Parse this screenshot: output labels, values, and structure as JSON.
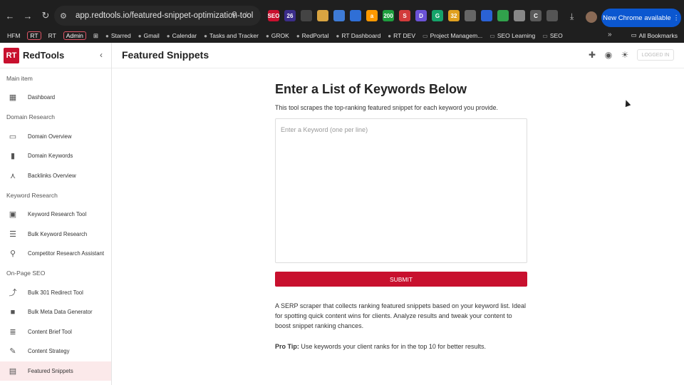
{
  "browser": {
    "url": "app.redtools.io/featured-snippet-optimization-tool",
    "new_chrome_label": "New Chrome available",
    "bookmarks": [
      {
        "label": "HFM",
        "icon": "text"
      },
      {
        "label": "RT",
        "icon": "badge"
      },
      {
        "label": "RT",
        "icon": "text"
      },
      {
        "label": "Admin",
        "icon": "badge"
      },
      {
        "label": "Starred",
        "icon": "drive-icon"
      },
      {
        "label": "Gmail",
        "icon": "gmail-icon"
      },
      {
        "label": "Calendar",
        "icon": "calendar-icon"
      },
      {
        "label": "Tasks and Tracker",
        "icon": "sheets-icon"
      },
      {
        "label": "GROK",
        "icon": "grok-icon"
      },
      {
        "label": "RedPortal",
        "icon": "portal-icon"
      },
      {
        "label": "RT Dashboard",
        "icon": "rt-icon"
      },
      {
        "label": "RT DEV",
        "icon": "dev-icon"
      },
      {
        "label": "Project Managem...",
        "icon": "folder-icon"
      },
      {
        "label": "SEO Learning",
        "icon": "folder-icon"
      },
      {
        "label": "SEO",
        "icon": "folder-icon"
      }
    ],
    "all_bookmarks_label": "All Bookmarks",
    "extensions": [
      {
        "label": "SEO",
        "color": "#c8102e"
      },
      {
        "label": "26",
        "color": "#3b2d8a"
      },
      {
        "label": "",
        "color": "#444444"
      },
      {
        "label": "",
        "color": "#d9a441"
      },
      {
        "label": "",
        "color": "#3e7bd6"
      },
      {
        "label": "",
        "color": "#2f6fd6"
      },
      {
        "label": "a",
        "color": "#ff9900"
      },
      {
        "label": "200",
        "color": "#1e9e3e"
      },
      {
        "label": "S",
        "color": "#d23b3b"
      },
      {
        "label": "D",
        "color": "#6b52d6"
      },
      {
        "label": "G",
        "color": "#15a36a"
      },
      {
        "label": "32",
        "color": "#e0a020"
      },
      {
        "label": "",
        "color": "#666666"
      },
      {
        "label": "",
        "color": "#2a62d6"
      },
      {
        "label": "",
        "color": "#31a24c"
      },
      {
        "label": "",
        "color": "#888888"
      },
      {
        "label": "C",
        "color": "#5a5a5a"
      },
      {
        "label": "",
        "color": "#555555"
      }
    ]
  },
  "sidebar": {
    "brand_logo": "RT",
    "brand_name": "RedTools",
    "sections": [
      {
        "title": "Main item",
        "items": [
          {
            "label": "Dashboard",
            "icon": "dashboard-icon",
            "glyph": "▦"
          }
        ]
      },
      {
        "title": "Domain Research",
        "items": [
          {
            "label": "Domain Overview",
            "icon": "laptop-search-icon",
            "glyph": "▭"
          },
          {
            "label": "Domain Keywords",
            "icon": "bar-chart-icon",
            "glyph": "▮"
          },
          {
            "label": "Backlinks Overview",
            "icon": "hub-icon",
            "glyph": "⋏"
          }
        ]
      },
      {
        "title": "Keyword Research",
        "items": [
          {
            "label": "Keyword Research Tool",
            "icon": "image-search-icon",
            "glyph": "▣"
          },
          {
            "label": "Bulk Keyword Research",
            "icon": "list-icon",
            "glyph": "☰"
          },
          {
            "label": "Competitor Research Assistant",
            "icon": "search-icon",
            "glyph": "⚲"
          }
        ]
      },
      {
        "title": "On-Page SEO",
        "items": [
          {
            "label": "Bulk 301 Redirect Tool",
            "icon": "merge-icon",
            "glyph": "⤴"
          },
          {
            "label": "Bulk Meta Data Generator",
            "icon": "rectangle-icon",
            "glyph": "■"
          },
          {
            "label": "Content Brief Tool",
            "icon": "bullet-list-icon",
            "glyph": "≣"
          },
          {
            "label": "Content Strategy",
            "icon": "pencil-icon",
            "glyph": "✎"
          },
          {
            "label": "Featured Snippets",
            "icon": "chat-icon",
            "glyph": "▤",
            "active": true
          }
        ]
      }
    ]
  },
  "header": {
    "title": "Featured Snippets",
    "logged_in_label": "LOGGED IN"
  },
  "main": {
    "heading": "Enter a List of Keywords Below",
    "description": "This tool scrapes the top-ranking featured snippet for each keyword you provide.",
    "input_placeholder": "Enter a Keyword (one per line)",
    "submit_label": "SUBMIT",
    "blurb": "A SERP scraper that collects ranking featured snippets based on your keyword list. Ideal for spotting quick content wins for clients. Analyze results and tweak your content to boost snippet ranking chances.",
    "tip_label": "Pro Tip:",
    "tip_text": " Use keywords your client ranks for in the top 10 for better results."
  }
}
